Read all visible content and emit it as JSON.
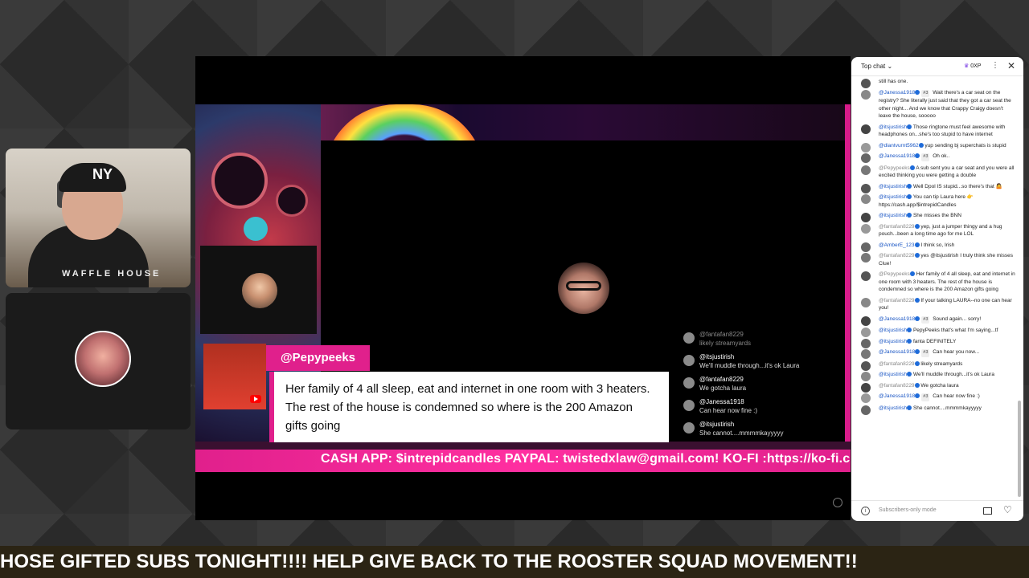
{
  "stream": {
    "overlay_name": "@Pepypeeks",
    "overlay_quote": "Her family of 4 all sleep, eat and internet in one room with 3 heaters. The rest of the house is condemned so where is the 200 Amazon gifts going",
    "donation_ticker": "CASH APP: $intrepidcandles PAYPAL: twistedxlaw@gmail.com! KO-FI :https://ko-fi.com",
    "bottom_ticker": "HOSE GIFTED SUBS TONIGHT!!!! HELP GIVE BACK TO THE ROOSTER SQUAD MOVEMENT!!",
    "host_cap_logo": "NY",
    "host_shirt_text": "WAFFLE HOUSE"
  },
  "mini_chat": [
    {
      "name": "@fantafan8229",
      "text": "likely streamyards",
      "dim": true
    },
    {
      "name": "@itsjustirish",
      "text": "We'll muddle through...it's ok Laura",
      "dim": false
    },
    {
      "name": "@fantafan8229",
      "text": "We gotcha laura",
      "dim": false
    },
    {
      "name": "@Janessa1918",
      "text": "Can hear now fine :)",
      "dim": false
    },
    {
      "name": "@itsjustirish",
      "text": "She cannot....mmmmkayyyyy",
      "dim": false
    }
  ],
  "chat": {
    "title": "Top chat",
    "xp": "0XP",
    "footer_placeholder": "Subscribers-only mode",
    "messages": [
      {
        "name": "",
        "text": "still has one.",
        "tag": ""
      },
      {
        "name": "@Janessa1918",
        "tag": "#3",
        "text": "Wait there's a car seat on the registry? She literally just said that they got a car seat the other night... And we know that Crappy Craigy doesn't leave the house, sooooo"
      },
      {
        "name": "@itsjustirish",
        "tag": "",
        "text": "Those ringtone must feel awesome with headphones on...she's too stupid to have internet"
      },
      {
        "name": "@diantvurnt5962",
        "tag": "",
        "text": "yup sending bj superchats is stupid"
      },
      {
        "name": "@Janessa1918",
        "tag": "#3",
        "text": "Oh ok.."
      },
      {
        "name": "@Pepypeeks",
        "tag": "",
        "text": "A sub sent you a car seat and you were all excited thinking you were getting a double"
      },
      {
        "name": "@itsjustirish",
        "tag": "",
        "text": "Well Dpol IS stupid...so there's that 🤷"
      },
      {
        "name": "@itsjustirish",
        "tag": "",
        "text": "You can tip Laura here 👉 https://cash.app/$intrepidCandles"
      },
      {
        "name": "@itsjustirish",
        "tag": "",
        "text": "She misses the BNN"
      },
      {
        "name": "@fantafan8229",
        "tag": "",
        "text": "yep, just a jumper thingy and a hug pouch...been a long time ago for me LOL"
      },
      {
        "name": "@AmberE_123",
        "tag": "",
        "text": "I think so, Irish"
      },
      {
        "name": "@fantafan8229",
        "tag": "",
        "text": "yes @itsjustirish I truly think she misses Clue!"
      },
      {
        "name": "@Pepypeeks",
        "tag": "",
        "text": "Her family of 4 all sleep, eat and internet in one room with 3 heaters. The rest of the house is condemned so where is the 200 Amazon gifts going"
      },
      {
        "name": "@fantafan8229",
        "tag": "",
        "text": "If your talking LAURA--no one can hear you!"
      },
      {
        "name": "@Janessa1918",
        "tag": "#3",
        "text": "Sound again... sorry!"
      },
      {
        "name": "@itsjustirish",
        "tag": "",
        "text": "PepyPeeks that's what I'm saying...tf"
      },
      {
        "name": "@itsjustirish",
        "tag": "",
        "text": "fanta DEFINITELY"
      },
      {
        "name": "@Janessa1918",
        "tag": "#3",
        "text": "Can hear you now..."
      },
      {
        "name": "@fantafan8229",
        "tag": "",
        "text": "likely streamyards"
      },
      {
        "name": "@itsjustirish",
        "tag": "",
        "text": "We'll muddle through...it's ok Laura"
      },
      {
        "name": "@fantafan8229",
        "tag": "",
        "text": "We gotcha laura"
      },
      {
        "name": "@Janessa1918",
        "tag": "#3",
        "text": "Can hear now fine :)"
      },
      {
        "name": "@itsjustirish",
        "tag": "",
        "text": "She cannot....mmmmkayyyyy"
      }
    ]
  },
  "colors": {
    "accent": "#e0208c",
    "chat_link": "#1a56c4",
    "ticker_bg": "#2b2414"
  }
}
